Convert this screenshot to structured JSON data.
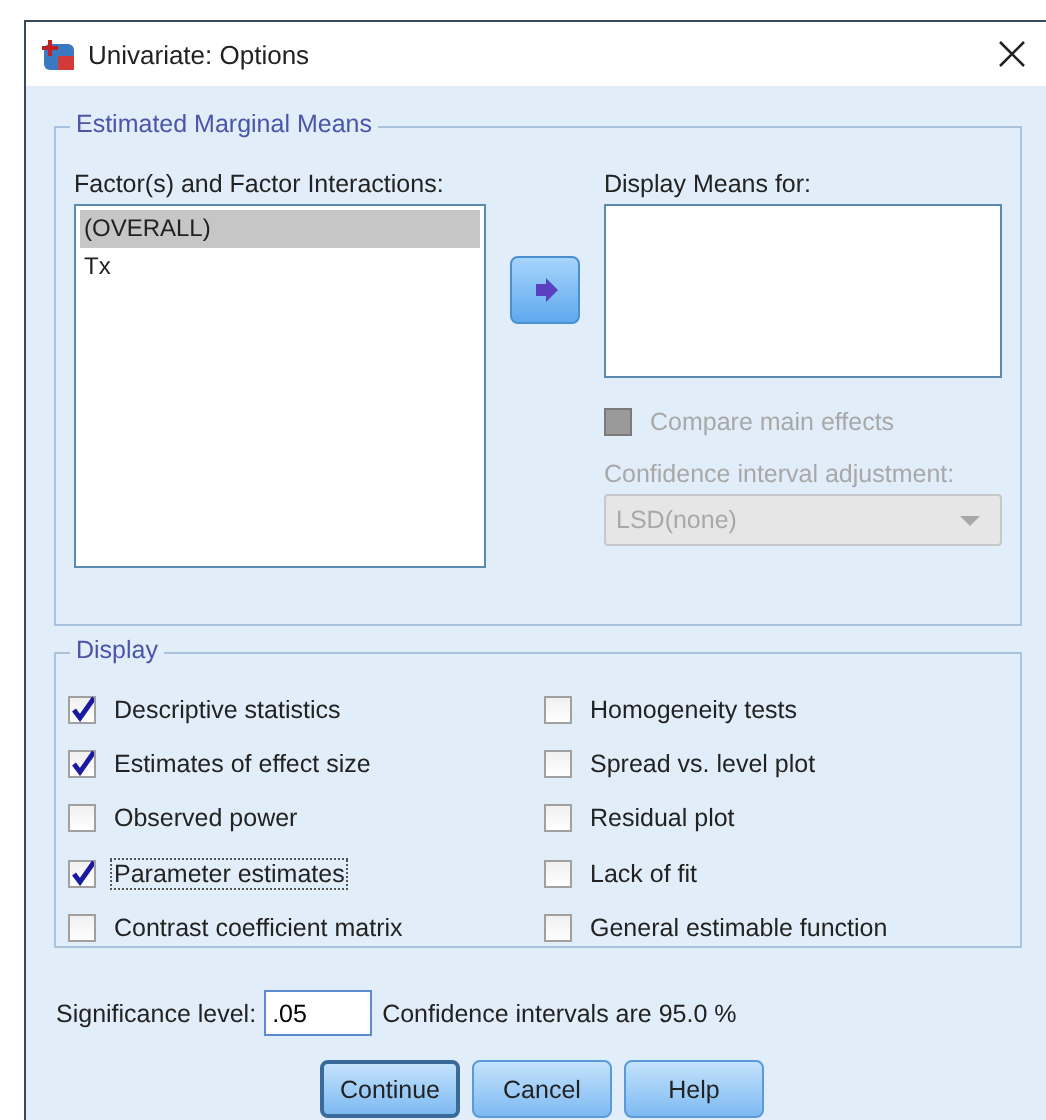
{
  "window": {
    "title": "Univariate: Options"
  },
  "estimated_marginal_means": {
    "title": "Estimated Marginal Means",
    "factors_label": "Factor(s) and Factor Interactions:",
    "factors": [
      {
        "label": "(OVERALL)",
        "selected": true
      },
      {
        "label": "Tx",
        "selected": false
      }
    ],
    "display_means_label": "Display Means for:",
    "compare_main_effects": {
      "label": "Compare main effects",
      "checked": false,
      "disabled": true
    },
    "ci_adjustment": {
      "label": "Confidence interval adjustment:",
      "value": "LSD(none)",
      "disabled": true
    }
  },
  "display": {
    "title": "Display",
    "left_options": [
      {
        "label": "Descriptive statistics",
        "checked": true,
        "focused": false
      },
      {
        "label": "Estimates of effect size",
        "checked": true,
        "focused": false
      },
      {
        "label": "Observed power",
        "checked": false,
        "focused": false
      },
      {
        "label": "Parameter estimates",
        "checked": true,
        "focused": true
      },
      {
        "label": "Contrast coefficient matrix",
        "checked": false,
        "focused": false
      }
    ],
    "right_options": [
      {
        "label": "Homogeneity tests",
        "checked": false,
        "focused": false
      },
      {
        "label": "Spread vs. level plot",
        "checked": false,
        "focused": false
      },
      {
        "label": "Residual plot",
        "checked": false,
        "focused": false
      },
      {
        "label": "Lack of fit",
        "checked": false,
        "focused": false
      },
      {
        "label": "General estimable function",
        "checked": false,
        "focused": false
      }
    ]
  },
  "significance": {
    "label": "Significance level:",
    "value": ".05",
    "note": "Confidence intervals are 95.0 %"
  },
  "buttons": [
    {
      "label": "Continue",
      "default": true
    },
    {
      "label": "Cancel",
      "default": false
    },
    {
      "label": "Help",
      "default": false
    }
  ]
}
